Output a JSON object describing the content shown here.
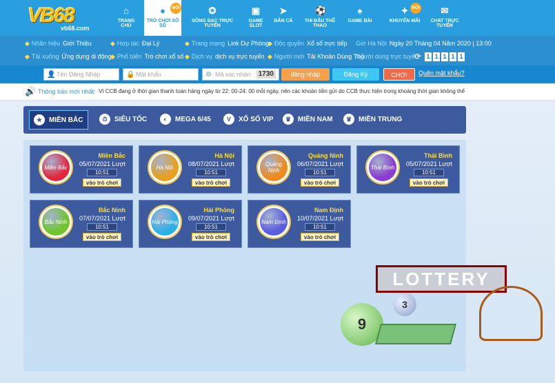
{
  "logo": {
    "brand": "VB68",
    "url": "vb68.com"
  },
  "nav": [
    {
      "label": "TRANG CHỦ",
      "icon": "home-icon",
      "glyph": "⌂"
    },
    {
      "label": "TRÒ CHƠI XỔ SỐ",
      "icon": "lottery-icon",
      "glyph": "●",
      "active": true,
      "badge": "MỚI"
    },
    {
      "label": "SÒNG BẠC TRỰC TUYẾN",
      "icon": "casino-icon",
      "glyph": "✪"
    },
    {
      "label": "GAME SLOT",
      "icon": "slot-icon",
      "glyph": "▣"
    },
    {
      "label": "BẮN CÁ",
      "icon": "fish-icon",
      "glyph": "➤"
    },
    {
      "label": "THI ĐẤU THỂ THAO",
      "icon": "football-icon",
      "glyph": "⚽"
    },
    {
      "label": "GAME BÀI",
      "icon": "cards-icon",
      "glyph": "♠"
    },
    {
      "label": "KHUYẾN MÃI",
      "icon": "gift-icon",
      "glyph": "✦",
      "badge": "MỚI"
    },
    {
      "label": "CHAT TRỰC TUYẾN",
      "icon": "chat-icon",
      "glyph": "✉"
    }
  ],
  "info": {
    "row1": [
      {
        "key": "Nhãn hiệu",
        "val": "Giới Thiệu",
        "icon": "trophy-icon"
      },
      {
        "key": "Hợp tác",
        "val": "Đại Lý",
        "icon": "handshake-icon"
      },
      {
        "key": "Trang mạng",
        "val": "Link Dự Phòng",
        "icon": "globe-icon"
      },
      {
        "key": "Độc quyền",
        "val": "Xổ số trực tiếp",
        "icon": "thumb-icon"
      },
      {
        "key": "Giờ Hà Nội",
        "val": "Ngày 20 Tháng 04 Năm 2020 | 13:00",
        "icon": ""
      }
    ],
    "row2": [
      {
        "key": "Tải xuống",
        "val": "Ứng dụng di động",
        "icon": "download-icon"
      },
      {
        "key": "Phổ biến",
        "val": "Trò chơi xổ số",
        "icon": "heart-icon"
      },
      {
        "key": "Dịch vụ",
        "val": "dịch vụ trực tuyến",
        "icon": "service-icon"
      },
      {
        "key": "Người mới",
        "val": "Tải Khoản Dùng Thử",
        "icon": "user-icon"
      },
      {
        "key": "Người dùng trực tuyến",
        "val": "",
        "icon": ""
      }
    ],
    "online_digits": [
      "1",
      "1",
      "1",
      "1",
      "1"
    ]
  },
  "login": {
    "username_placeholder": "Tên Đăng Nhập",
    "password_placeholder": "Mật khẩu",
    "captcha_placeholder": "Mã xác nhận",
    "captcha_code": "1730",
    "login_btn": "đăng nhập",
    "register_btn": "Đăng Ký",
    "trial_btn": "CHƠI THỬ",
    "forgot": "Quên mật khẩu?"
  },
  "notice": {
    "label": "Thông báo mới nhất:",
    "text": "Vì CCB đang ở thời gian thanh toán hàng ngày từ 22: 00-24: 00 mỗi ngày, nên các khoản tiền gửi do CCB thực hiện trong khoảng thời gian không thể"
  },
  "tabs": [
    {
      "label": "MIỀN BẮC",
      "glyph": "★",
      "active": true
    },
    {
      "label": "SIÊU TỐC",
      "glyph": "⏱"
    },
    {
      "label": "MEGA 6/45",
      "glyph": "◐"
    },
    {
      "label": "XỔ SỐ VIP",
      "glyph": "V"
    },
    {
      "label": "MIỀN NAM",
      "glyph": "♛"
    },
    {
      "label": "MIỀN TRUNG",
      "glyph": "♛"
    }
  ],
  "cards": [
    {
      "name": "Miền Bắc",
      "ball": "Miền Bắc",
      "date": "05/07/2021 Lượt",
      "time": "10:51",
      "play": "vào trò chơi",
      "color": "#e3263b"
    },
    {
      "name": "Hà Nội",
      "ball": "Hà Nội",
      "date": "08/07/2021 Lượt",
      "time": "10:51",
      "play": "vào trò chơi",
      "color": "#e8a11d"
    },
    {
      "name": "Quảng Ninh",
      "ball": "Quảng Ninh",
      "date": "06/07/2021 Lượt",
      "time": "10:51",
      "play": "vào trò chơi",
      "color": "#f08a1d"
    },
    {
      "name": "Thái Bình",
      "ball": "Thái Bình",
      "date": "05/07/2021 Lượt",
      "time": "10:51",
      "play": "vào trò chơi",
      "color": "#8a3dd0"
    },
    {
      "name": "Bắc Ninh",
      "ball": "Bắc Ninh",
      "date": "07/07/2021 Lượt",
      "time": "10:51",
      "play": "vào trò chơi",
      "color": "#6fc52a"
    },
    {
      "name": "Hải Phòng",
      "ball": "Hải Phòng",
      "date": "09/07/2021 Lượt",
      "time": "10:51",
      "play": "vào trò chơi",
      "color": "#2cb0e8"
    },
    {
      "name": "Nam Định",
      "ball": "Nam Định",
      "date": "10/07/2021 Lượt",
      "time": "10:51",
      "play": "vào trò chơi",
      "color": "#5a5de0"
    }
  ],
  "deco": {
    "lottery_text": "LOTTERY",
    "ball_9": "9",
    "ball_3": "3"
  }
}
